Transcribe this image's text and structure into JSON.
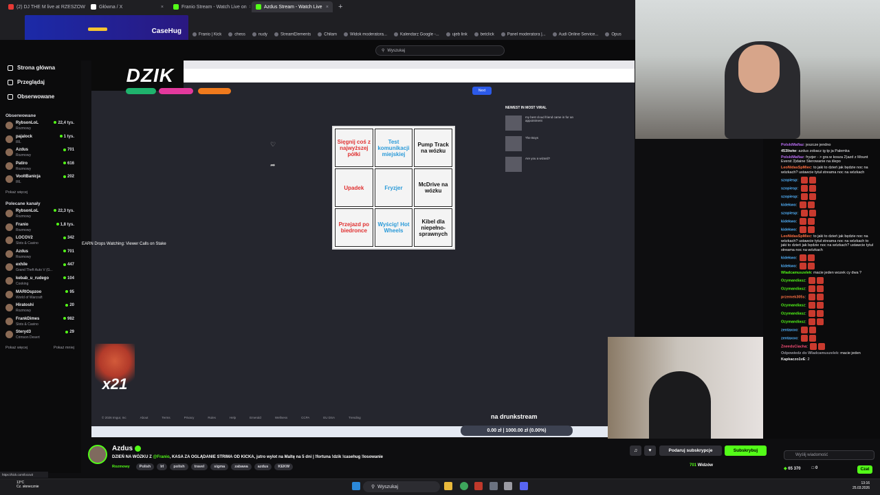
{
  "browser": {
    "tabs": [
      {
        "label": "(2) DJ THE M live at RZESZOWS",
        "icon_color": "#e53935"
      },
      {
        "label": "Główna / X",
        "icon_color": "#ffffff"
      },
      {
        "label": "Franio Stream - Watch Live on",
        "icon_color": "#53fc18"
      },
      {
        "label": "Azdus Stream - Watch Live",
        "icon_color": "#53fc18"
      }
    ],
    "new_tab": "+",
    "bookmarks": [
      "Franio | Kick",
      "chess",
      "nudy",
      "StreamElements",
      "Chiłam",
      "Widok moderatora...",
      "Kalendarz Google -...",
      "ujeb link",
      "betclick",
      "Panel moderatora |...",
      "Audi Online Service...",
      "Opus"
    ],
    "banner_text": "CaseHug",
    "status_url": "https://kick.com/locov2"
  },
  "kick": {
    "search_placeholder": "Wyszukaj",
    "nav": [
      {
        "label": "Strona główna",
        "icon": "home-icon"
      },
      {
        "label": "Przeglądaj",
        "icon": "browse-icon"
      },
      {
        "label": "Obserwowane",
        "icon": "heart-icon"
      }
    ],
    "followed_title": "Obserwowane",
    "followed": [
      {
        "name": "RybsonLoL",
        "category": "Rozmowy",
        "viewers": "22,4 tys."
      },
      {
        "name": "pajalock",
        "category": "IRL",
        "viewers": "1 tys."
      },
      {
        "name": "Azdus",
        "category": "Rozmowy",
        "viewers": "701"
      },
      {
        "name": "Patiro",
        "category": "Rozmowy",
        "viewers": "616"
      },
      {
        "name": "VooltBanicja",
        "category": "IRL",
        "viewers": "202"
      }
    ],
    "show_more": "Pokaż więcej",
    "recommended_title": "Polecane kanały",
    "recommended": [
      {
        "name": "RybsonLoL",
        "category": "Rozmowy",
        "viewers": "22,3 tys."
      },
      {
        "name": "Franio",
        "category": "Rozmowy",
        "viewers": "1,8 tys."
      },
      {
        "name": "LOCOV2",
        "category": "Slots & Casino",
        "viewers": "342"
      },
      {
        "name": "Azdus",
        "category": "Rozmowy",
        "viewers": "701"
      },
      {
        "name": "exhile",
        "category": "Grand Theft Auto V (G...",
        "viewers": "447"
      },
      {
        "name": "kebab_u_rudego",
        "category": "Cooking",
        "viewers": "104"
      },
      {
        "name": "MARIOspzoo",
        "category": "World of Warcraft",
        "viewers": "95"
      },
      {
        "name": "Hiratoshi",
        "category": "Rozmowy",
        "viewers": "20"
      },
      {
        "name": "FrankDimes",
        "category": "Slots & Casino",
        "viewers": "982"
      },
      {
        "name": "Steryd3",
        "category": "Crimson Desert",
        "viewers": "29"
      }
    ],
    "show_more_2": "Pokaż więcej",
    "show_less": "Pokaż mniej"
  },
  "stream_overlay": {
    "logo": "DZIK",
    "earn_text": "EARN Drops Watching: Viewer Calls on Stake",
    "bottom_text": "na drunkstream",
    "price_text": "0.00 zł | 1000.00 zł  (0.00%)",
    "combo": "x21",
    "next_button": "Next",
    "viral_title": "NEWEST IN MOST VIRAL",
    "viral_items": [
      "my best cloud friend came in for an appointment",
      "The Boys",
      "Are you a wizard?"
    ],
    "footer_links": [
      "© 2026 Imgur, Inc",
      "About",
      "Terms",
      "Privacy",
      "Rules",
      "Help",
      "Emerald",
      "Wellness",
      "CCPA",
      "EU DSA",
      "Trending"
    ],
    "meme_cells": [
      "Sięgnij coś z najwyższej półki",
      "Test komunikacji miejskiej",
      "Pump Track na wózku",
      "Upadek",
      "Fryzjer",
      "McDrive na wózku",
      "Przejazd po biedronce",
      "Wyścig! Hot Wheels",
      "Kibel dla niepełno-sprawnych"
    ]
  },
  "chat": {
    "messages": [
      {
        "user": "PolskiMafiaz",
        "color": "#b86df2",
        "text": "jeszcze jendno"
      },
      {
        "user": "453liwiw",
        "color": "#efeff1",
        "text": "azdus zobacz ig tp ja Palemka"
      },
      {
        "user": "PolskiMafiaz",
        "color": "#b86df2",
        "text": "fryzjer - > gra w kosza 2)azd z Mount Everst 3)daine Sterowanie na ślepo"
      },
      {
        "user": "LeoNidasSpMiec",
        "color": "#ff7043",
        "text": "to jaki to dzień jak będzie noc na wózkach? ustawcie tytuł streama noc na wózkach"
      },
      {
        "user": "szopiesp",
        "color": "#53b4ff",
        "text": ""
      },
      {
        "user": "szopiesp",
        "color": "#53b4ff",
        "text": ""
      },
      {
        "user": "szopiesp",
        "color": "#53b4ff",
        "text": ""
      },
      {
        "user": "kidekwo",
        "color": "#53b4ff",
        "text": ""
      },
      {
        "user": "szopiesp",
        "color": "#53b4ff",
        "text": ""
      },
      {
        "user": "kidekwo",
        "color": "#53b4ff",
        "text": ""
      },
      {
        "user": "kidekwo",
        "color": "#53b4ff",
        "text": ""
      },
      {
        "user": "LeoNidasSpMiec",
        "color": "#ff7043",
        "text": "to jaki to dzień jak będzie noc na wózkach? ustawcie tytuł streama noc na wózkach to jaki to dzień jak będzie noc na wózkach? ustawcie tytuł streama noc na wózkach"
      },
      {
        "user": "kidekwo",
        "color": "#53b4ff",
        "text": ""
      },
      {
        "user": "kidekwo",
        "color": "#53b4ff",
        "text": ""
      },
      {
        "user": "Wladcamuszelek",
        "color": "#53fc18",
        "text": "macie jeden wozek cy dwa ?"
      },
      {
        "user": "Ozymandiasz",
        "color": "#53fc18",
        "text": ""
      },
      {
        "user": "Ozymandiasz",
        "color": "#53fc18",
        "text": ""
      },
      {
        "user": "przemek305s",
        "color": "#ff7043",
        "text": ""
      },
      {
        "user": "Ozymandiasz",
        "color": "#53fc18",
        "text": ""
      },
      {
        "user": "Ozymandiasz",
        "color": "#53fc18",
        "text": ""
      },
      {
        "user": "Ozymandiasz",
        "color": "#53fc18",
        "text": ""
      },
      {
        "user": "zentaxoo",
        "color": "#53b4ff",
        "text": ""
      },
      {
        "user": "zentaxoo",
        "color": "#53b4ff",
        "text": ""
      },
      {
        "user": "ZneedsCiacha",
        "color": "#ff4f7a",
        "text": ""
      },
      {
        "user": "Odpowiedz do Wladcamuszelek",
        "color": "#9a9aa2",
        "text": "macie jeden"
      },
      {
        "user": "Kapkaczo1vE",
        "color": "#efeff1",
        "text": "2"
      }
    ],
    "input_placeholder": "Wyślij wiadomość",
    "send_label": "Czat",
    "points": "65 370",
    "count": "0"
  },
  "stream_info": {
    "streamer": "Azdus",
    "title_pre": "DZIEŃ NA WÓZKU Z ",
    "title_mention": "@Franio",
    "title_post": ", KASA ZA OGLĄDANIE STRIMA OD KICKA, jutro wylot na Maltę na 5  dni | !fortuna !dzik !casehug !losowanie",
    "category": "Rozmowy",
    "tags": [
      "Polish",
      "Irl",
      "polish",
      "travel",
      "sigma",
      "zabawa",
      "azdus",
      "KEKW"
    ],
    "gift_label": "Podaruj subskrypcje",
    "subscribe_label": "Subskrybuj",
    "viewers_count": "701",
    "viewers_label": "Widzów"
  },
  "taskbar": {
    "search": "Wyszukaj",
    "weather_temp": "13°C",
    "weather_desc": "Cz. słonecznie",
    "time": "13:16",
    "date": "25.03.2026"
  },
  "colors": {
    "kick_green": "#53fc18",
    "bg": "#0e0e10"
  }
}
